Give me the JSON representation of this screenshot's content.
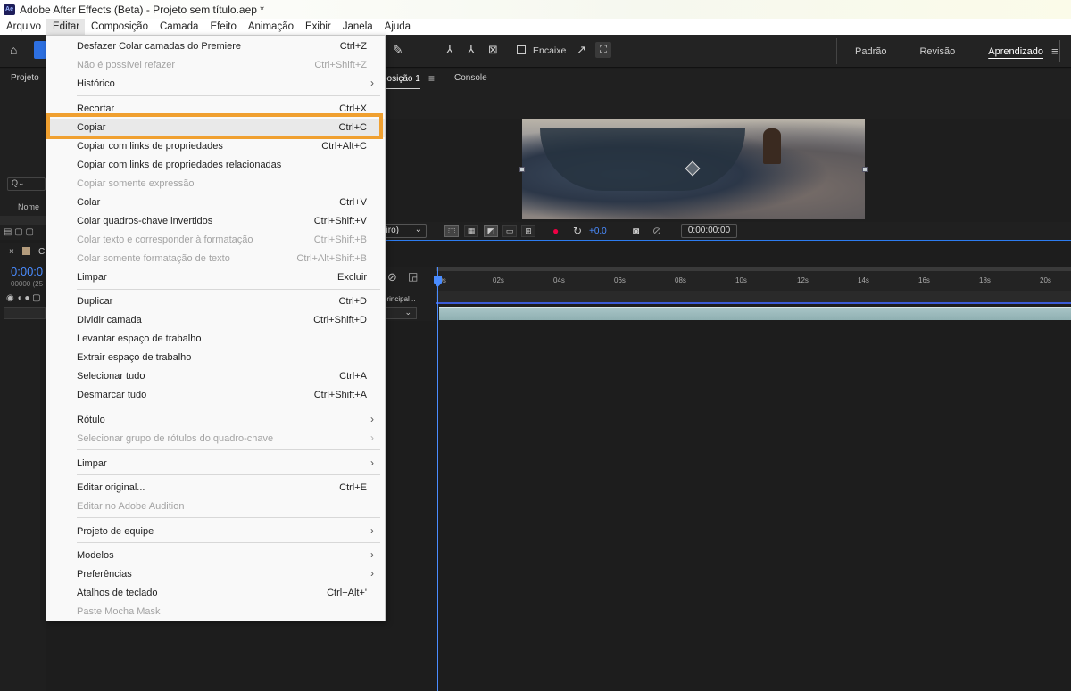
{
  "window": {
    "title": "Adobe After Effects (Beta) - Projeto sem título.aep *",
    "app_icon": "Ae"
  },
  "menubar": [
    "Arquivo",
    "Editar",
    "Composição",
    "Camada",
    "Efeito",
    "Animação",
    "Exibir",
    "Janela",
    "Ajuda"
  ],
  "toolbar": {
    "snap_label": "Encaixe",
    "workspaces": [
      "Padrão",
      "Revisão",
      "Aprendizado"
    ]
  },
  "panels": {
    "project_tab": "Projeto",
    "comp_tab": "posição 1",
    "console_tab": "Console",
    "name_col": "Nome",
    "search_icon": "Q⌄"
  },
  "viewer": {
    "zoom_fragment": "eiro)",
    "exposure": "+0.0",
    "timecode": "0:00:00:00"
  },
  "timeline": {
    "comp_label": "C",
    "timecode": "0:00:0",
    "frame_info": "00000 (25",
    "layer_fragment": "principal ..",
    "ticks": [
      "00s",
      "02s",
      "04s",
      "06s",
      "08s",
      "10s",
      "12s",
      "14s",
      "16s",
      "18s",
      "20s"
    ]
  },
  "menu": {
    "accent_color": "#f0a030",
    "items": [
      {
        "label": "Desfazer Colar camadas do Premiere",
        "shortcut": "Ctrl+Z",
        "enabled": true
      },
      {
        "label": "Não é possível refazer",
        "shortcut": "Ctrl+Shift+Z",
        "enabled": false
      },
      {
        "label": "Histórico",
        "shortcut": "",
        "enabled": true,
        "submenu": true
      },
      {
        "label": "Recortar",
        "shortcut": "Ctrl+X",
        "enabled": true
      },
      {
        "label": "Copiar",
        "shortcut": "Ctrl+C",
        "enabled": true,
        "highlighted": true
      },
      {
        "label": "Copiar com links de propriedades",
        "shortcut": "Ctrl+Alt+C",
        "enabled": true
      },
      {
        "label": "Copiar com links de propriedades relacionadas",
        "shortcut": "",
        "enabled": true
      },
      {
        "label": "Copiar somente expressão",
        "shortcut": "",
        "enabled": false
      },
      {
        "label": "Colar",
        "shortcut": "Ctrl+V",
        "enabled": true
      },
      {
        "label": "Colar quadros-chave invertidos",
        "shortcut": "Ctrl+Shift+V",
        "enabled": true
      },
      {
        "label": "Colar texto e corresponder à formatação",
        "shortcut": "Ctrl+Shift+B",
        "enabled": false
      },
      {
        "label": "Colar somente formatação de texto",
        "shortcut": "Ctrl+Alt+Shift+B",
        "enabled": false
      },
      {
        "label": "Limpar",
        "shortcut": "Excluir",
        "enabled": true
      },
      {
        "label": "Duplicar",
        "shortcut": "Ctrl+D",
        "enabled": true
      },
      {
        "label": "Dividir camada",
        "shortcut": "Ctrl+Shift+D",
        "enabled": true
      },
      {
        "label": "Levantar espaço de trabalho",
        "shortcut": "",
        "enabled": true
      },
      {
        "label": "Extrair espaço de trabalho",
        "shortcut": "",
        "enabled": true
      },
      {
        "label": "Selecionar tudo",
        "shortcut": "Ctrl+A",
        "enabled": true
      },
      {
        "label": "Desmarcar tudo",
        "shortcut": "Ctrl+Shift+A",
        "enabled": true
      },
      {
        "label": "Rótulo",
        "shortcut": "",
        "enabled": true,
        "submenu": true
      },
      {
        "label": "Selecionar grupo de rótulos do quadro-chave",
        "shortcut": "",
        "enabled": false,
        "submenu": true
      },
      {
        "label": "Limpar",
        "shortcut": "",
        "enabled": true,
        "submenu": true
      },
      {
        "label": "Editar original...",
        "shortcut": "Ctrl+E",
        "enabled": true
      },
      {
        "label": "Editar no Adobe Audition",
        "shortcut": "",
        "enabled": false
      },
      {
        "label": "Projeto de equipe",
        "shortcut": "",
        "enabled": true,
        "submenu": true
      },
      {
        "label": "Modelos",
        "shortcut": "",
        "enabled": true,
        "submenu": true
      },
      {
        "label": "Preferências",
        "shortcut": "",
        "enabled": true,
        "submenu": true
      },
      {
        "label": "Atalhos de teclado",
        "shortcut": "Ctrl+Alt+'",
        "enabled": true
      },
      {
        "label": "Paste Mocha Mask",
        "shortcut": "",
        "enabled": false
      }
    ]
  }
}
